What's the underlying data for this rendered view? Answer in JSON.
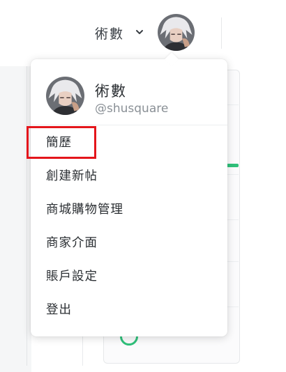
{
  "header": {
    "username": "術數",
    "dropdown_icon": "chevron-down-icon",
    "avatar_icon": "avatar"
  },
  "menu": {
    "profile": {
      "name": "術數",
      "handle": "@shusquare"
    },
    "items": [
      {
        "label": "簡歷"
      },
      {
        "label": "創建新帖"
      },
      {
        "label": "商城購物管理"
      },
      {
        "label": "商家介面"
      },
      {
        "label": "賬戶設定"
      },
      {
        "label": "登出"
      }
    ]
  },
  "colors": {
    "highlight": "#e4151b",
    "accent": "#2fc07a",
    "text": "#2b2f33",
    "muted": "#8a9096"
  }
}
